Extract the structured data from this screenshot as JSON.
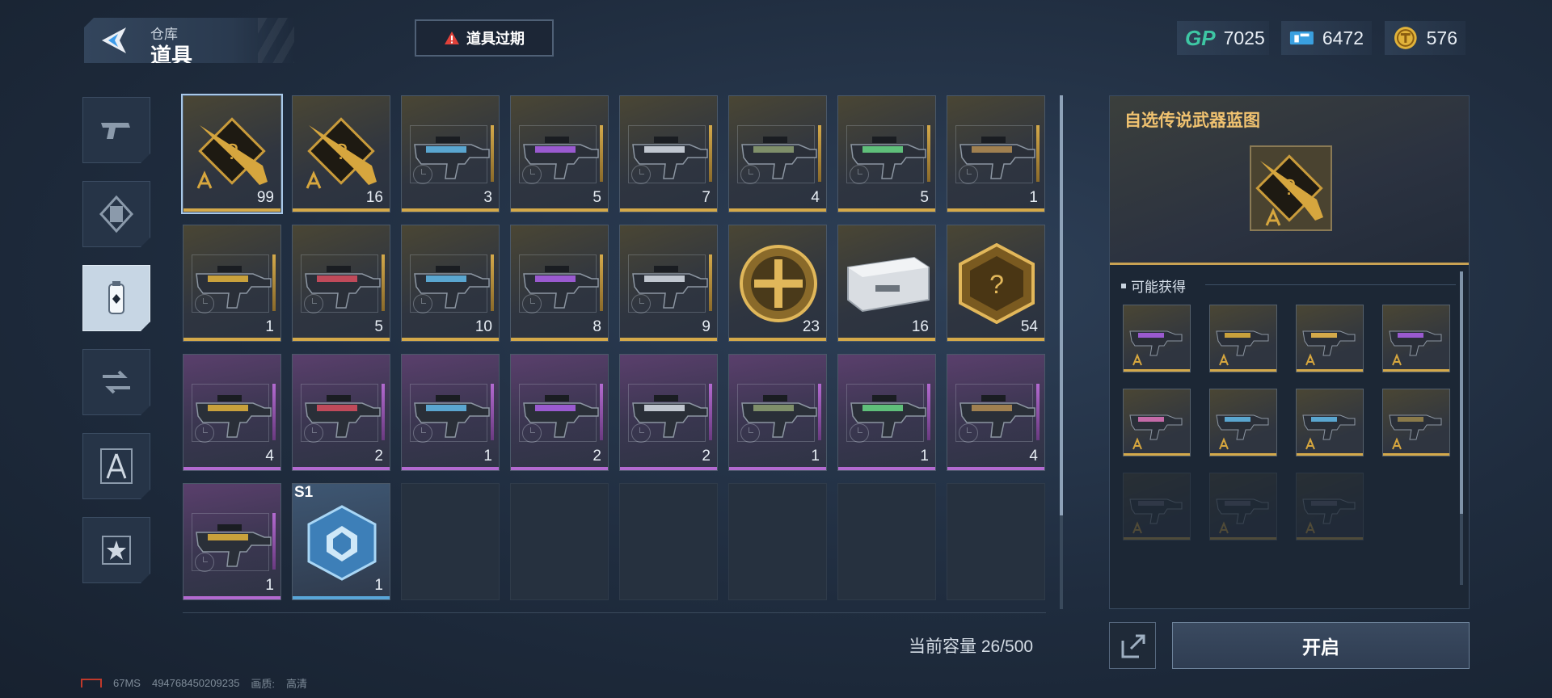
{
  "header": {
    "back_label": "仓库",
    "title": "道具",
    "expire_button": "道具过期"
  },
  "currencies": [
    {
      "icon": "gp-icon",
      "label": "GP",
      "value": "7025",
      "color": "#3ec7a4"
    },
    {
      "icon": "ticket-icon",
      "value": "6472",
      "color": "#3aa0e0"
    },
    {
      "icon": "coin-icon",
      "value": "576",
      "color": "#e0b23a"
    }
  ],
  "sidebar": {
    "items": [
      {
        "name": "weapon-tab",
        "icon": "pistol-icon",
        "active": false
      },
      {
        "name": "skin-tab",
        "icon": "card-icon",
        "active": false
      },
      {
        "name": "item-tab",
        "icon": "canister-icon",
        "active": true
      },
      {
        "name": "exchange-tab",
        "icon": "exchange-icon",
        "active": false
      },
      {
        "name": "blueprint-tab",
        "icon": "compass-icon",
        "active": false
      },
      {
        "name": "badge-tab",
        "icon": "star-badge-icon",
        "active": false
      }
    ]
  },
  "inventory": {
    "items": [
      {
        "rarity": "gold",
        "kind": "blueprint",
        "count": "99",
        "selected": true
      },
      {
        "rarity": "gold",
        "kind": "blueprint",
        "count": "16"
      },
      {
        "rarity": "gold",
        "kind": "gun",
        "count": "3",
        "clock": true
      },
      {
        "rarity": "gold",
        "kind": "gun",
        "count": "5",
        "clock": true
      },
      {
        "rarity": "gold",
        "kind": "gun",
        "count": "7",
        "clock": true
      },
      {
        "rarity": "gold",
        "kind": "gun",
        "count": "4",
        "clock": true
      },
      {
        "rarity": "gold",
        "kind": "gun",
        "count": "5",
        "clock": true
      },
      {
        "rarity": "gold",
        "kind": "gun",
        "count": "1",
        "clock": true
      },
      {
        "rarity": "gold",
        "kind": "gun",
        "count": "1",
        "clock": true
      },
      {
        "rarity": "gold",
        "kind": "gun",
        "count": "5",
        "clock": true
      },
      {
        "rarity": "gold",
        "kind": "gun",
        "count": "10",
        "clock": true
      },
      {
        "rarity": "gold",
        "kind": "gun",
        "count": "8",
        "clock": true
      },
      {
        "rarity": "gold",
        "kind": "gun",
        "count": "9",
        "clock": true
      },
      {
        "rarity": "gold",
        "kind": "medal",
        "count": "23"
      },
      {
        "rarity": "gold",
        "kind": "case",
        "count": "16"
      },
      {
        "rarity": "gold",
        "kind": "hexbadge",
        "count": "54"
      },
      {
        "rarity": "purple",
        "kind": "gun",
        "count": "4",
        "clock": true
      },
      {
        "rarity": "purple",
        "kind": "gun",
        "count": "2",
        "clock": true
      },
      {
        "rarity": "purple",
        "kind": "gun",
        "count": "1",
        "clock": true
      },
      {
        "rarity": "purple",
        "kind": "gun",
        "count": "2",
        "clock": true
      },
      {
        "rarity": "purple",
        "kind": "gun",
        "count": "2",
        "clock": true
      },
      {
        "rarity": "purple",
        "kind": "gun",
        "count": "1",
        "clock": true
      },
      {
        "rarity": "purple",
        "kind": "gun",
        "count": "1",
        "clock": true
      },
      {
        "rarity": "purple",
        "kind": "gun",
        "count": "4",
        "clock": true
      },
      {
        "rarity": "purple",
        "kind": "gun",
        "count": "1",
        "clock": true
      },
      {
        "rarity": "blue",
        "kind": "cube",
        "count": "1",
        "season": "S1"
      }
    ],
    "empty_slots": 6,
    "capacity_text": "当前容量 26/500"
  },
  "detail": {
    "title": "自选传说武器蓝图",
    "possible_label": "可能获得",
    "rewards_active": 8,
    "rewards_dim": 3
  },
  "actions": {
    "open_label": "开启"
  },
  "footer": {
    "ping": "67MS",
    "uid": "494768450209235",
    "quality_label": "画质:",
    "quality_value": "高清"
  }
}
